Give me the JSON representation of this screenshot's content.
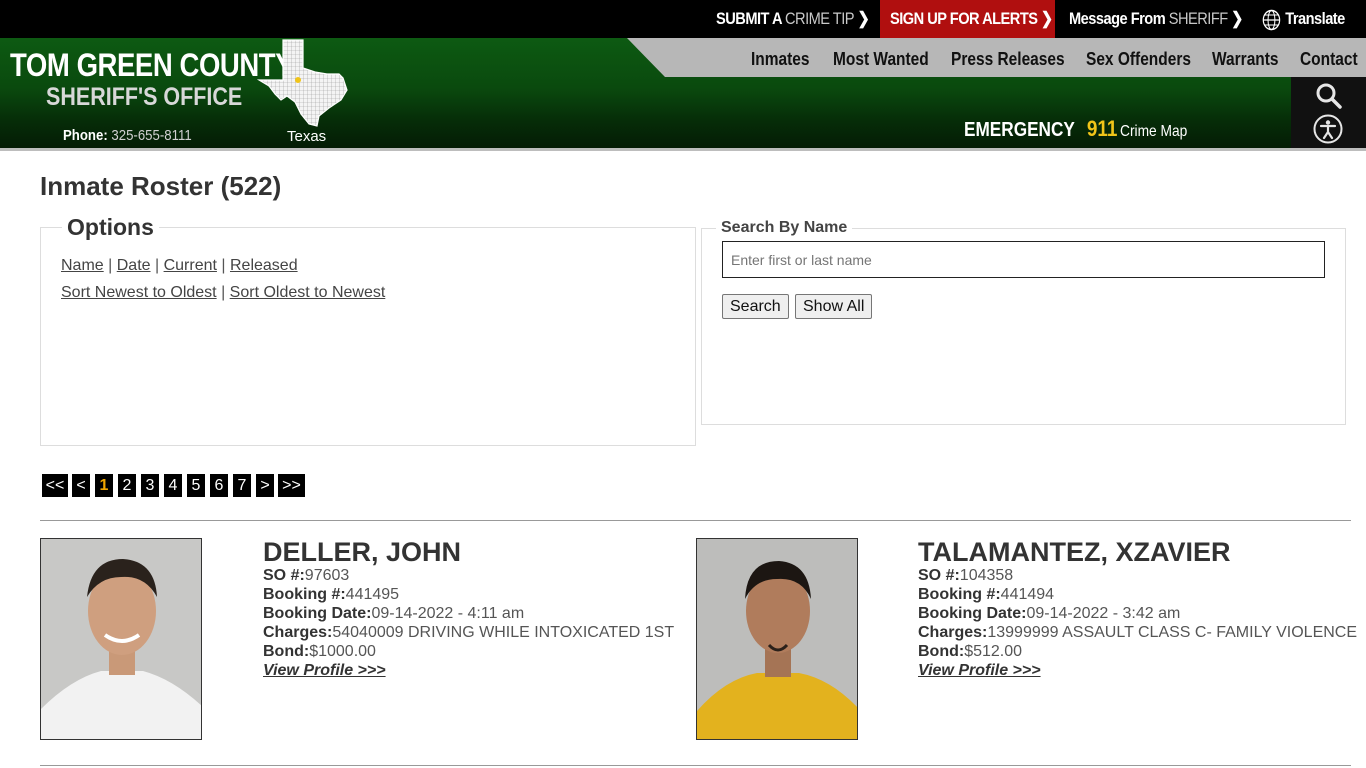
{
  "topbar": {
    "crime_tip_a": "SUBMIT A ",
    "crime_tip_b": "CRIME TIP",
    "alerts": "SIGN UP FOR ALERTS",
    "message_a": "Message From ",
    "message_b": "SHERIFF",
    "translate": "Translate"
  },
  "header": {
    "county": "TOM GREEN COUNTY",
    "office": "SHERIFF'S OFFICE",
    "phone_label": "Phone:",
    "phone_number": "325-655-8111",
    "state_label": "Texas",
    "emergency_label": "EMERGENCY",
    "emergency_number": "911",
    "crime_map": "Crime Map"
  },
  "nav": [
    "Inmates",
    "Most Wanted",
    "Press Releases",
    "Sex Offenders",
    "Warrants",
    "Contact"
  ],
  "page": {
    "title": "Inmate Roster (522)",
    "options_legend": "Options",
    "sort_links": [
      "Name",
      "Date",
      "Current",
      "Released"
    ],
    "order_links": [
      "Sort Newest to Oldest",
      "Sort Oldest to Newest"
    ],
    "search_legend": "Search By Name",
    "search_placeholder": "Enter first or last name",
    "search_button": "Search",
    "show_all_button": "Show All"
  },
  "pager": [
    "<<",
    "<",
    "1",
    "2",
    "3",
    "4",
    "5",
    "6",
    "7",
    ">",
    ">>"
  ],
  "pager_active": "1",
  "inmates": [
    {
      "name": "DELLER, JOHN",
      "so_label": "SO #:",
      "so": "97603",
      "booking_label": "Booking #:",
      "booking": "441495",
      "date_label": "Booking Date:",
      "date": "09-14-2022 - 4:11 am",
      "charges_label": "Charges:",
      "charges": "54040009 DRIVING WHILE INTOXICATED 1ST",
      "bond_label": "Bond:",
      "bond": "$1000.00",
      "view": "View Profile >>>"
    },
    {
      "name": "TALAMANTEZ, XZAVIER",
      "so_label": "SO #:",
      "so": "104358",
      "booking_label": "Booking #:",
      "booking": "441494",
      "date_label": "Booking Date:",
      "date": "09-14-2022 - 3:42 am",
      "charges_label": "Charges:",
      "charges": "13999999 ASSAULT CLASS C- FAMILY VIOLENCE",
      "bond_label": "Bond:",
      "bond": "$512.00",
      "view": "View Profile >>>"
    }
  ],
  "colors": {
    "header_green": "#0a4a0e",
    "alert_red": "#b00f0f",
    "accent_yellow": "#f0c419",
    "nav_gray": "#b7b7b7"
  }
}
